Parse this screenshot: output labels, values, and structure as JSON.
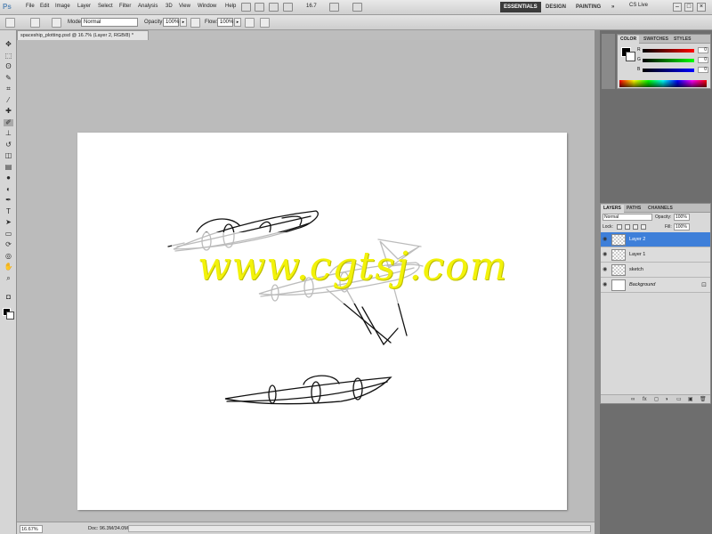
{
  "app": {
    "logo": "Ps",
    "menu": [
      "File",
      "Edit",
      "Image",
      "Layer",
      "Select",
      "Filter",
      "Analysis",
      "3D",
      "View",
      "Window",
      "Help"
    ],
    "zoom_readout": "16.7",
    "workspaces": [
      "ESSENTIALS",
      "DESIGN",
      "PAINTING",
      "»"
    ],
    "cs_live": "CS Live",
    "win_controls": [
      "–",
      "□",
      "×"
    ]
  },
  "options_bar": {
    "mode_label": "Mode:",
    "mode_value": "Normal",
    "opacity_label": "Opacity:",
    "opacity_value": "100%",
    "flow_label": "Flow:",
    "flow_value": "100%"
  },
  "toolbox": {
    "tools": [
      "move-tool",
      "marquee-tool",
      "lasso-tool",
      "quick-selection-tool",
      "crop-tool",
      "eyedropper-tool",
      "healing-brush-tool",
      "brush-tool",
      "clone-stamp-tool",
      "history-brush-tool",
      "eraser-tool",
      "gradient-tool",
      "blur-tool",
      "dodge-tool",
      "pen-tool",
      "type-tool",
      "path-selection-tool",
      "shape-tool",
      "3d-rotate-tool",
      "3d-camera-tool",
      "hand-tool",
      "zoom-tool"
    ],
    "glyphs": [
      "✥",
      "⬚",
      "ʘ",
      "✎",
      "⌗",
      "⁄",
      "✚",
      "✐",
      "⊥",
      "↺",
      "◫",
      "▤",
      "●",
      "◐",
      "✒",
      "T",
      "➤",
      "▭",
      "⟳",
      "◎",
      "✋",
      "⌕"
    ],
    "active_index": 7,
    "quick_mask": "◘"
  },
  "document": {
    "tab_title": "spaceship_plotting.psd @ 16.7% (Layer 2, RGB/8) *",
    "watermark": "www.cgtsj.com"
  },
  "status": {
    "zoom": "16.67%",
    "doc_info": "Doc: 96.3M/34.0M"
  },
  "color_panel": {
    "tabs": [
      "COLOR",
      "SWATCHES",
      "STYLES"
    ],
    "channels": [
      {
        "name": "R",
        "value": "0"
      },
      {
        "name": "G",
        "value": "0"
      },
      {
        "name": "B",
        "value": "0"
      }
    ]
  },
  "layers_panel": {
    "tabs": [
      "LAYERS",
      "PATHS",
      "CHANNELS"
    ],
    "blend_mode": "Normal",
    "opacity_label": "Opacity:",
    "opacity_value": "100%",
    "lock_label": "Lock:",
    "fill_label": "Fill:",
    "fill_value": "100%",
    "layers": [
      {
        "name": "Layer 2",
        "selected": true,
        "type": "transparent"
      },
      {
        "name": "Layer 1",
        "selected": false,
        "type": "transparent"
      },
      {
        "name": "sketch",
        "selected": false,
        "type": "transparent"
      },
      {
        "name": "Background",
        "selected": false,
        "type": "solid",
        "locked": true
      }
    ],
    "footer_icons": [
      "link-icon",
      "fx-icon",
      "mask-icon",
      "adjustment-icon",
      "group-icon",
      "new-layer-icon",
      "trash-icon"
    ],
    "footer_glyphs": [
      "∞",
      "fx",
      "◻",
      "◑",
      "▭",
      "▣",
      "🗑"
    ]
  },
  "colors": {
    "selected_layer": "#3e7fd9",
    "watermark": "#f2f20a"
  }
}
